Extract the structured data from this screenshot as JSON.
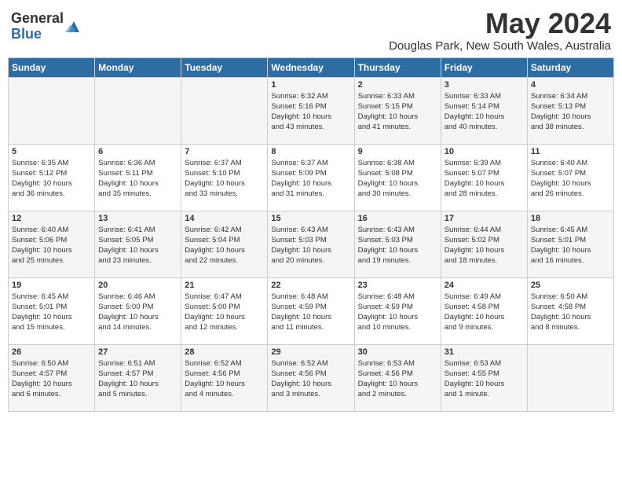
{
  "header": {
    "logo_general": "General",
    "logo_blue": "Blue",
    "month_year": "May 2024",
    "location": "Douglas Park, New South Wales, Australia"
  },
  "days_of_week": [
    "Sunday",
    "Monday",
    "Tuesday",
    "Wednesday",
    "Thursday",
    "Friday",
    "Saturday"
  ],
  "weeks": [
    [
      {
        "day": "",
        "info": ""
      },
      {
        "day": "",
        "info": ""
      },
      {
        "day": "",
        "info": ""
      },
      {
        "day": "1",
        "info": "Sunrise: 6:32 AM\nSunset: 5:16 PM\nDaylight: 10 hours\nand 43 minutes."
      },
      {
        "day": "2",
        "info": "Sunrise: 6:33 AM\nSunset: 5:15 PM\nDaylight: 10 hours\nand 41 minutes."
      },
      {
        "day": "3",
        "info": "Sunrise: 6:33 AM\nSunset: 5:14 PM\nDaylight: 10 hours\nand 40 minutes."
      },
      {
        "day": "4",
        "info": "Sunrise: 6:34 AM\nSunset: 5:13 PM\nDaylight: 10 hours\nand 38 minutes."
      }
    ],
    [
      {
        "day": "5",
        "info": "Sunrise: 6:35 AM\nSunset: 5:12 PM\nDaylight: 10 hours\nand 36 minutes."
      },
      {
        "day": "6",
        "info": "Sunrise: 6:36 AM\nSunset: 5:11 PM\nDaylight: 10 hours\nand 35 minutes."
      },
      {
        "day": "7",
        "info": "Sunrise: 6:37 AM\nSunset: 5:10 PM\nDaylight: 10 hours\nand 33 minutes."
      },
      {
        "day": "8",
        "info": "Sunrise: 6:37 AM\nSunset: 5:09 PM\nDaylight: 10 hours\nand 31 minutes."
      },
      {
        "day": "9",
        "info": "Sunrise: 6:38 AM\nSunset: 5:08 PM\nDaylight: 10 hours\nand 30 minutes."
      },
      {
        "day": "10",
        "info": "Sunrise: 6:39 AM\nSunset: 5:07 PM\nDaylight: 10 hours\nand 28 minutes."
      },
      {
        "day": "11",
        "info": "Sunrise: 6:40 AM\nSunset: 5:07 PM\nDaylight: 10 hours\nand 26 minutes."
      }
    ],
    [
      {
        "day": "12",
        "info": "Sunrise: 6:40 AM\nSunset: 5:06 PM\nDaylight: 10 hours\nand 25 minutes."
      },
      {
        "day": "13",
        "info": "Sunrise: 6:41 AM\nSunset: 5:05 PM\nDaylight: 10 hours\nand 23 minutes."
      },
      {
        "day": "14",
        "info": "Sunrise: 6:42 AM\nSunset: 5:04 PM\nDaylight: 10 hours\nand 22 minutes."
      },
      {
        "day": "15",
        "info": "Sunrise: 6:43 AM\nSunset: 5:03 PM\nDaylight: 10 hours\nand 20 minutes."
      },
      {
        "day": "16",
        "info": "Sunrise: 6:43 AM\nSunset: 5:03 PM\nDaylight: 10 hours\nand 19 minutes."
      },
      {
        "day": "17",
        "info": "Sunrise: 6:44 AM\nSunset: 5:02 PM\nDaylight: 10 hours\nand 18 minutes."
      },
      {
        "day": "18",
        "info": "Sunrise: 6:45 AM\nSunset: 5:01 PM\nDaylight: 10 hours\nand 16 minutes."
      }
    ],
    [
      {
        "day": "19",
        "info": "Sunrise: 6:45 AM\nSunset: 5:01 PM\nDaylight: 10 hours\nand 15 minutes."
      },
      {
        "day": "20",
        "info": "Sunrise: 6:46 AM\nSunset: 5:00 PM\nDaylight: 10 hours\nand 14 minutes."
      },
      {
        "day": "21",
        "info": "Sunrise: 6:47 AM\nSunset: 5:00 PM\nDaylight: 10 hours\nand 12 minutes."
      },
      {
        "day": "22",
        "info": "Sunrise: 6:48 AM\nSunset: 4:59 PM\nDaylight: 10 hours\nand 11 minutes."
      },
      {
        "day": "23",
        "info": "Sunrise: 6:48 AM\nSunset: 4:59 PM\nDaylight: 10 hours\nand 10 minutes."
      },
      {
        "day": "24",
        "info": "Sunrise: 6:49 AM\nSunset: 4:58 PM\nDaylight: 10 hours\nand 9 minutes."
      },
      {
        "day": "25",
        "info": "Sunrise: 6:50 AM\nSunset: 4:58 PM\nDaylight: 10 hours\nand 8 minutes."
      }
    ],
    [
      {
        "day": "26",
        "info": "Sunrise: 6:50 AM\nSunset: 4:57 PM\nDaylight: 10 hours\nand 6 minutes."
      },
      {
        "day": "27",
        "info": "Sunrise: 6:51 AM\nSunset: 4:57 PM\nDaylight: 10 hours\nand 5 minutes."
      },
      {
        "day": "28",
        "info": "Sunrise: 6:52 AM\nSunset: 4:56 PM\nDaylight: 10 hours\nand 4 minutes."
      },
      {
        "day": "29",
        "info": "Sunrise: 6:52 AM\nSunset: 4:56 PM\nDaylight: 10 hours\nand 3 minutes."
      },
      {
        "day": "30",
        "info": "Sunrise: 6:53 AM\nSunset: 4:56 PM\nDaylight: 10 hours\nand 2 minutes."
      },
      {
        "day": "31",
        "info": "Sunrise: 6:53 AM\nSunset: 4:55 PM\nDaylight: 10 hours\nand 1 minute."
      },
      {
        "day": "",
        "info": ""
      }
    ]
  ]
}
